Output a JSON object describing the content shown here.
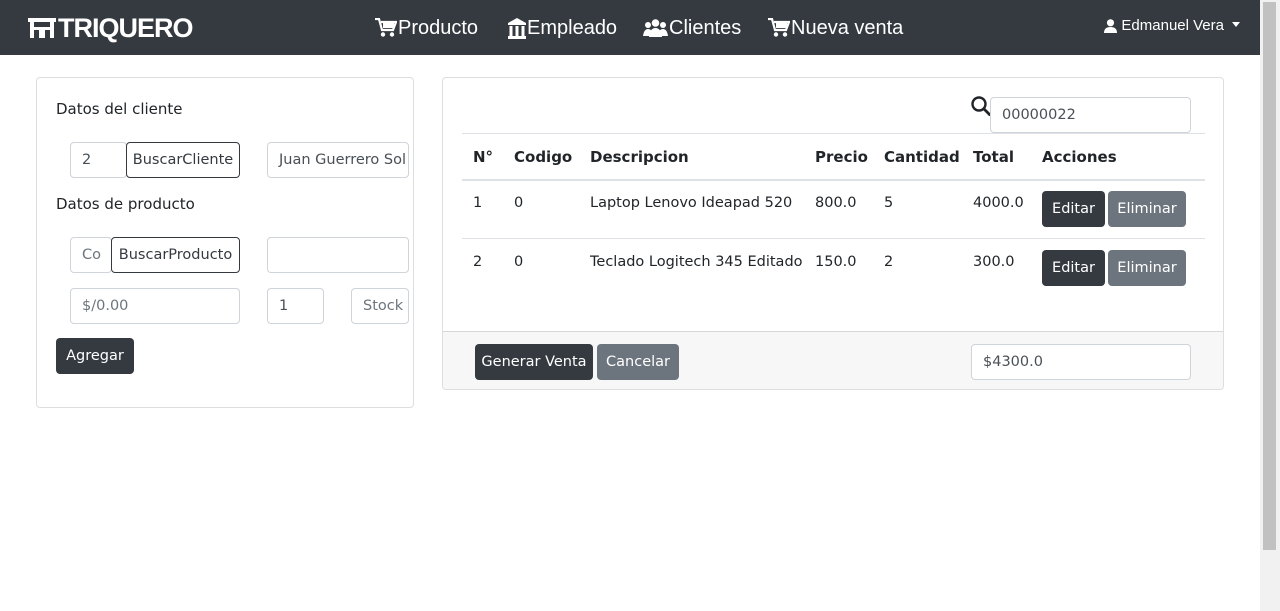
{
  "brand": {
    "name": "TRIQUERO"
  },
  "nav": {
    "items": [
      {
        "label": "Producto",
        "icon": "cart-icon"
      },
      {
        "label": "Empleado",
        "icon": "building-icon"
      },
      {
        "label": "Clientes",
        "icon": "users-icon"
      },
      {
        "label": "Nueva venta",
        "icon": "cart-icon"
      }
    ],
    "user": {
      "name": "Edmanuel Vera",
      "icon": "user-icon"
    }
  },
  "client_form": {
    "client_section_label": "Datos del cliente",
    "client_code_value": "2",
    "search_client_label": "BuscarCliente",
    "client_name_value": "Juan Guerrero Sol",
    "product_section_label": "Datos de producto",
    "product_code_placeholder": "Co",
    "search_product_label": "BuscarProducto",
    "product_name_value": "",
    "price_placeholder": "$/0.00",
    "quantity_value": "1",
    "stock_placeholder": "Stock",
    "add_label": "Agregar"
  },
  "sale": {
    "invoice_number": "00000022",
    "columns": [
      "N°",
      "Codigo",
      "Descripcion",
      "Precio",
      "Cantidad",
      "Total",
      "Acciones"
    ],
    "rows": [
      {
        "n": "1",
        "codigo": "0",
        "descripcion": "Laptop Lenovo Ideapad 520",
        "precio": "800.0",
        "cantidad": "5",
        "total": "4000.0"
      },
      {
        "n": "2",
        "codigo": "0",
        "descripcion": "Teclado Logitech 345 Editado",
        "precio": "150.0",
        "cantidad": "2",
        "total": "300.0"
      }
    ],
    "edit_label": "Editar",
    "delete_label": "Eliminar",
    "generate_label": "Generar Venta",
    "cancel_label": "Cancelar",
    "total_value": "$4300.0"
  },
  "colors": {
    "navbar": "#343a40",
    "dark_button": "#343a40",
    "secondary_button": "#6c757d",
    "footer_bg": "#f7f7f7"
  }
}
